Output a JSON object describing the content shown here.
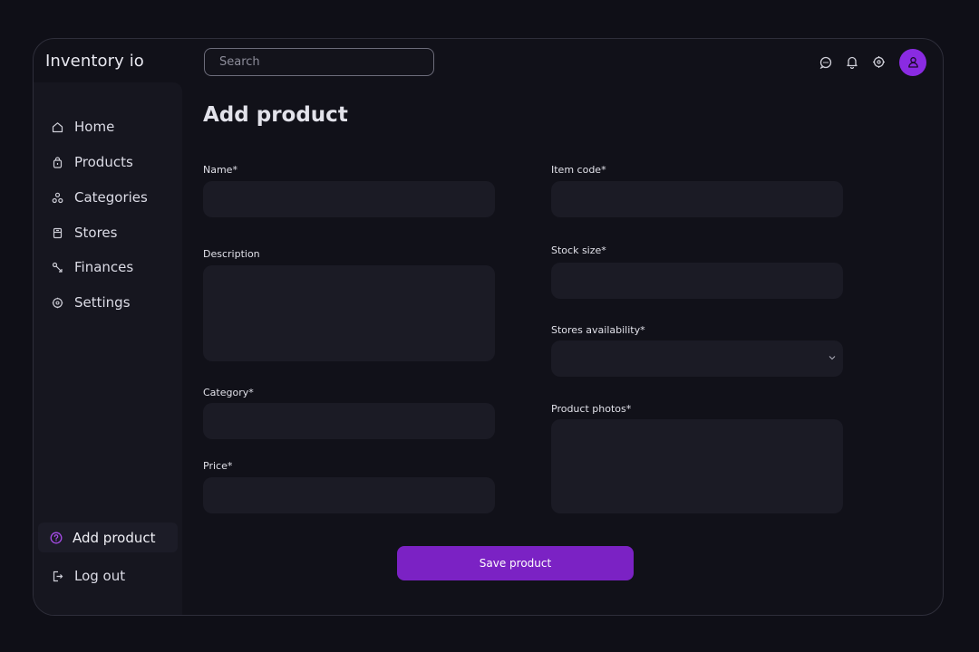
{
  "app": {
    "brand": "Inventory io"
  },
  "search": {
    "placeholder": "Search"
  },
  "header": {
    "icons": [
      "chat-icon",
      "bell-icon",
      "gear-icon",
      "user-icon"
    ]
  },
  "sidebar": {
    "items": [
      {
        "label": "Home",
        "icon": "home-icon"
      },
      {
        "label": "Products",
        "icon": "bag-icon"
      },
      {
        "label": "Categories",
        "icon": "categories-icon"
      },
      {
        "label": "Stores",
        "icon": "store-icon"
      },
      {
        "label": "Finances",
        "icon": "finances-icon"
      },
      {
        "label": "Settings",
        "icon": "settings-icon"
      }
    ],
    "active": {
      "label": "Add product",
      "icon": "help-circle-icon"
    },
    "logout": {
      "label": "Log out",
      "icon": "logout-icon"
    }
  },
  "main": {
    "title": "Add product",
    "fields": {
      "name": {
        "label": "Name*",
        "value": ""
      },
      "description": {
        "label": "Description",
        "value": ""
      },
      "category": {
        "label": "Category*",
        "value": ""
      },
      "price": {
        "label": "Price*",
        "value": ""
      },
      "item_code": {
        "label": "Item code*",
        "value": ""
      },
      "stock_size": {
        "label": "Stock size*",
        "value": ""
      },
      "stores_availability": {
        "label": "Stores availability*",
        "value": ""
      },
      "product_photos": {
        "label": "Product photos*"
      }
    },
    "save_label": "Save product"
  },
  "colors": {
    "accent": "#7b22c4",
    "avatar": "#8a2be2",
    "field_bg": "#1b1b25"
  }
}
